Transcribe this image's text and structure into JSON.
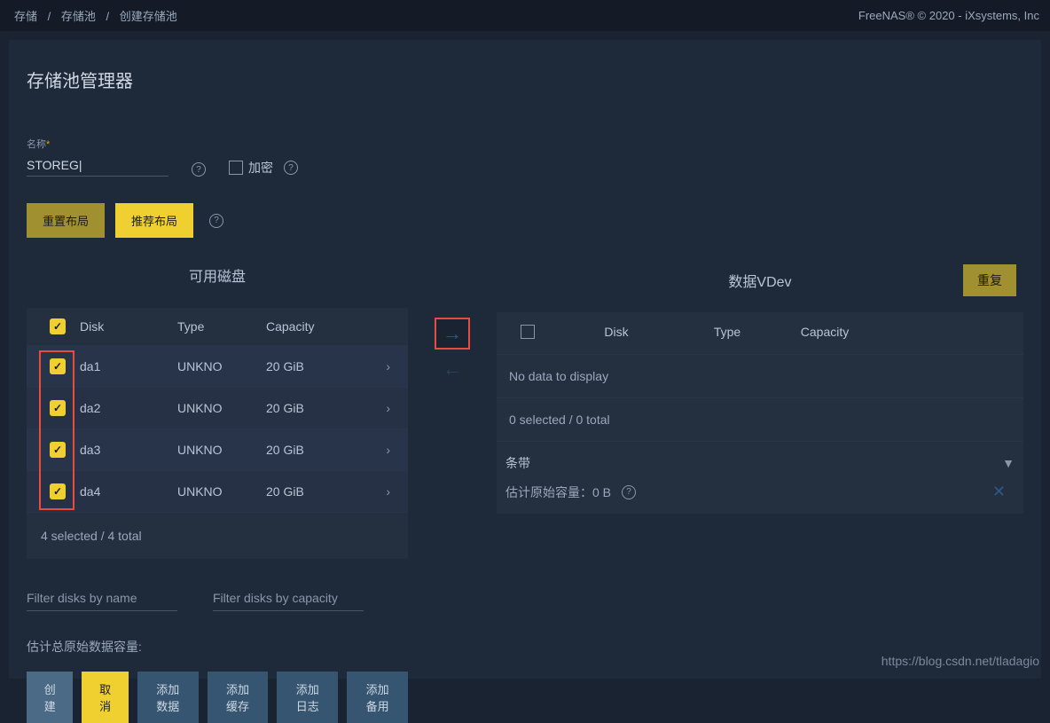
{
  "breadcrumb": {
    "a": "存储",
    "b": "存储池",
    "c": "创建存储池"
  },
  "copyright": "FreeNAS® © 2020 - iXsystems, Inc",
  "page_title": "存储池管理器",
  "name_field": {
    "label": "名称",
    "value": "STOREG|"
  },
  "encrypt_label": "加密",
  "buttons": {
    "reset_layout": "重置布局",
    "suggest_layout": "推荐布局"
  },
  "available_disks_title": "可用磁盘",
  "table": {
    "headers": {
      "disk": "Disk",
      "type": "Type",
      "capacity": "Capacity"
    },
    "rows": [
      {
        "disk": "da1",
        "type": "UNKNO",
        "capacity": "20 GiB"
      },
      {
        "disk": "da2",
        "type": "UNKNO",
        "capacity": "20 GiB"
      },
      {
        "disk": "da3",
        "type": "UNKNO",
        "capacity": "20 GiB"
      },
      {
        "disk": "da4",
        "type": "UNKNO",
        "capacity": "20 GiB"
      }
    ],
    "footer": "4 selected / 4 total"
  },
  "filter": {
    "by_name": "Filter disks by name",
    "by_capacity": "Filter disks by capacity"
  },
  "estimated_total": "估计总原始数据容量:",
  "actions": {
    "create": "创建",
    "cancel": "取消",
    "add_data": "添加数据",
    "add_cache": "添加缓存",
    "add_log": "添加日志",
    "add_spare": "添加备用"
  },
  "vdev": {
    "title": "数据VDev",
    "reset": "重复",
    "headers": {
      "disk": "Disk",
      "type": "Type",
      "capacity": "Capacity"
    },
    "no_data": "No data to display",
    "footer": "0 selected / 0 total",
    "layout": "条带",
    "est_raw": "估计原始容量：0 B"
  },
  "watermark": "https://blog.csdn.net/tladagio"
}
